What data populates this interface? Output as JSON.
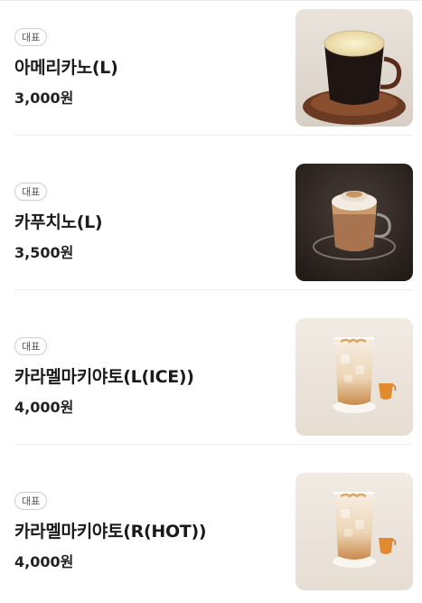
{
  "menu": {
    "items": [
      {
        "badge": "대표",
        "name": "아메리카노(L)",
        "price": "3,000원",
        "image": "americano-photo"
      },
      {
        "badge": "대표",
        "name": "카푸치노(L)",
        "price": "3,500원",
        "image": "cappuccino-photo"
      },
      {
        "badge": "대표",
        "name": "카라멜마키야토(L(ICE))",
        "price": "4,000원",
        "image": "iced-caramel-macchiato-photo"
      },
      {
        "badge": "대표",
        "name": "카라멜마키야토(R(HOT))",
        "price": "4,000원",
        "image": "hot-caramel-macchiato-photo"
      }
    ]
  },
  "colors": {
    "background": "#ffffff",
    "divider": "#efefef",
    "badge_border": "#cfcfcf"
  }
}
